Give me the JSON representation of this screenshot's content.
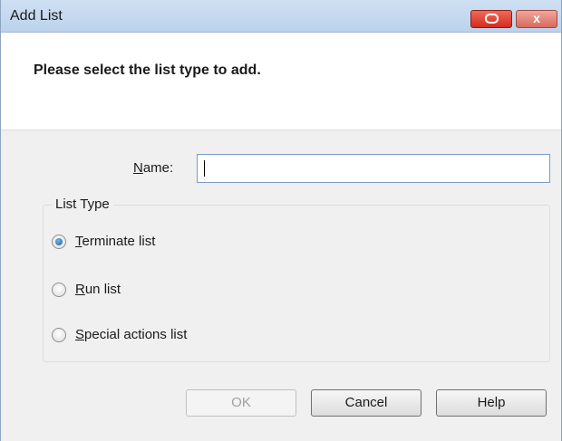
{
  "window": {
    "title": "Add List",
    "close_label": "x"
  },
  "header": {
    "instruction": "Please select the list type to add."
  },
  "form": {
    "name_label_mnemonic": "N",
    "name_label_rest": "ame:",
    "name_value": ""
  },
  "list_type": {
    "title": "List Type",
    "selected": "terminate",
    "options": [
      {
        "id": "terminate",
        "mnemonic": "T",
        "rest": "erminate list"
      },
      {
        "id": "run",
        "mnemonic": "R",
        "rest": "un list"
      },
      {
        "id": "special",
        "mnemonic": "S",
        "rest": "pecial actions list"
      }
    ]
  },
  "buttons": {
    "ok": "OK",
    "cancel": "Cancel",
    "help": "Help"
  },
  "colors": {
    "accent": "#1c5ea8",
    "close_red": "#d62a1c"
  }
}
